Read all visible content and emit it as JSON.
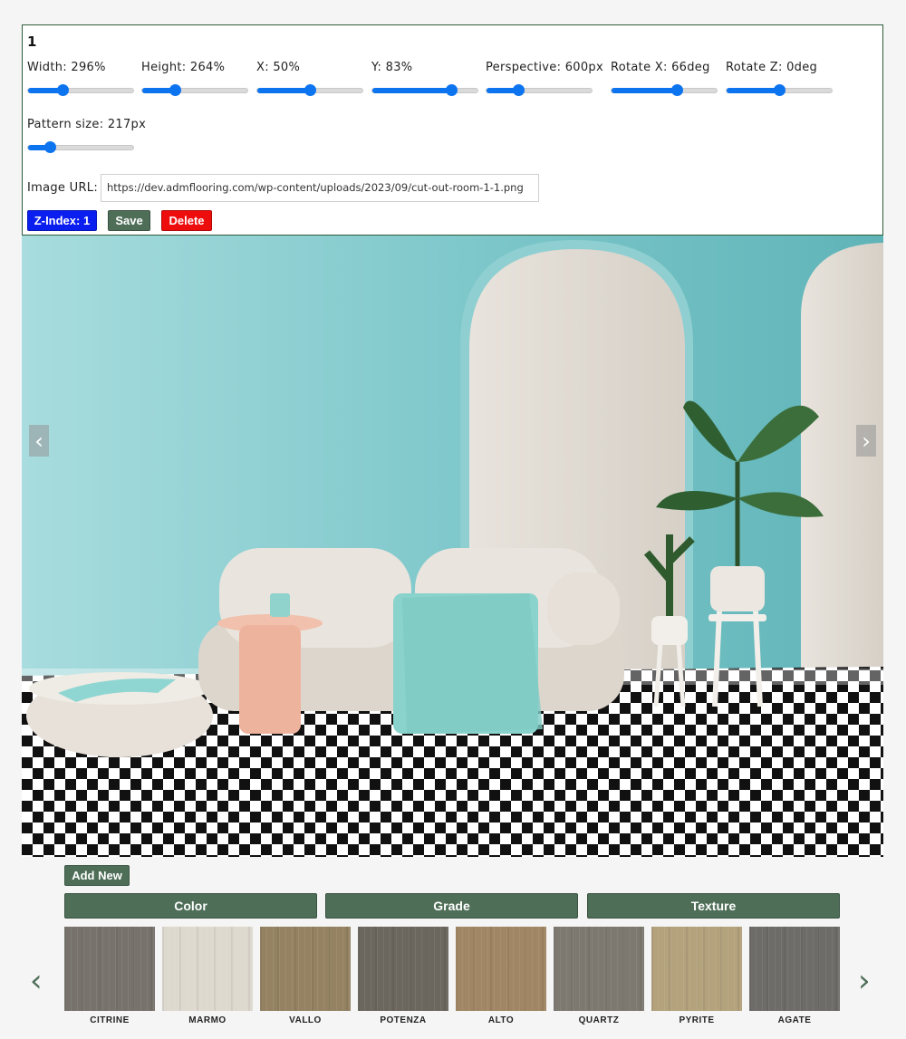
{
  "editor": {
    "layer_id": "1",
    "controls": [
      {
        "label": "Width: 296%",
        "value": 0.33
      },
      {
        "label": "Height: 264%",
        "value": 0.31
      },
      {
        "label": "X: 50%",
        "value": 0.5
      },
      {
        "label": "Y: 83%",
        "value": 0.75
      },
      {
        "label": "Perspective: 600px",
        "value": 0.3
      },
      {
        "label": "Rotate X: 66deg",
        "value": 0.62
      },
      {
        "label": "Rotate Z: 0deg",
        "value": 0.5
      },
      {
        "label": "Pattern size: 217px",
        "value": 0.21
      }
    ],
    "url_label": "Image URL:",
    "url_value": "https://dev.admflooring.com/wp-content/uploads/2023/09/cut-out-room-1-1.png",
    "zindex_label": "Z-Index: 1",
    "save_label": "Save",
    "delete_label": "Delete"
  },
  "preview": {
    "prev_icon": "chevron-left-icon",
    "next_icon": "chevron-right-icon",
    "wall_color": "#7fc8cb",
    "floor_pattern": "black-white-checkerboard"
  },
  "toolbar": {
    "add_new_label": "Add New",
    "tabs": [
      "Color",
      "Grade",
      "Texture"
    ]
  },
  "swatches": [
    {
      "name": "CITRINE",
      "color": "#77736c"
    },
    {
      "name": "MARMO",
      "color": "#ddd9cf"
    },
    {
      "name": "VALLO",
      "color": "#948262"
    },
    {
      "name": "POTENZA",
      "color": "#6b675f"
    },
    {
      "name": "ALTO",
      "color": "#a08664"
    },
    {
      "name": "QUARTZ",
      "color": "#7d7870"
    },
    {
      "name": "PYRITE",
      "color": "#b3a27c"
    },
    {
      "name": "AGATE",
      "color": "#6d6c69"
    }
  ],
  "colors": {
    "accent": "#4e6e58",
    "slider": "#0d74f0",
    "zindex": "#0a1ef0",
    "delete": "#ee0d0d"
  }
}
